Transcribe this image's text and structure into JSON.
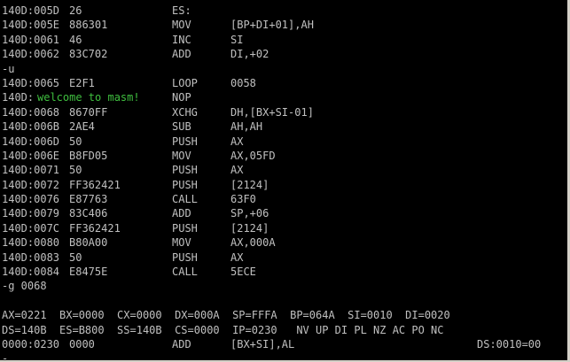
{
  "disasm1": [
    {
      "addr": "140D:005D",
      "bytes": "26",
      "mnem": "ES:",
      "op": ""
    },
    {
      "addr": "140D:005E",
      "bytes": "886301",
      "mnem": "MOV",
      "op": "[BP+DI+01],AH"
    },
    {
      "addr": "140D:0061",
      "bytes": "46",
      "mnem": "INC",
      "op": "SI"
    },
    {
      "addr": "140D:0062",
      "bytes": "83C702",
      "mnem": "ADD",
      "op": "DI,+02"
    }
  ],
  "cmd_u": "-u",
  "disasm2": [
    {
      "addr": "140D:0065",
      "bytes": "E2F1",
      "mnem": "LOOP",
      "op": "0058"
    }
  ],
  "welcome_line": {
    "addr": "140D:",
    "text": "welcome to masm!",
    "mnem": "NOP"
  },
  "disasm3": [
    {
      "addr": "140D:0068",
      "bytes": "8670FF",
      "mnem": "XCHG",
      "op": "DH,[BX+SI-01]"
    },
    {
      "addr": "140D:006B",
      "bytes": "2AE4",
      "mnem": "SUB",
      "op": "AH,AH"
    },
    {
      "addr": "140D:006D",
      "bytes": "50",
      "mnem": "PUSH",
      "op": "AX"
    },
    {
      "addr": "140D:006E",
      "bytes": "B8FD05",
      "mnem": "MOV",
      "op": "AX,05FD"
    },
    {
      "addr": "140D:0071",
      "bytes": "50",
      "mnem": "PUSH",
      "op": "AX"
    },
    {
      "addr": "140D:0072",
      "bytes": "FF362421",
      "mnem": "PUSH",
      "op": "[2124]"
    },
    {
      "addr": "140D:0076",
      "bytes": "E87763",
      "mnem": "CALL",
      "op": "63F0"
    },
    {
      "addr": "140D:0079",
      "bytes": "83C406",
      "mnem": "ADD",
      "op": "SP,+06"
    },
    {
      "addr": "140D:007C",
      "bytes": "FF362421",
      "mnem": "PUSH",
      "op": "[2124]"
    },
    {
      "addr": "140D:0080",
      "bytes": "B80A00",
      "mnem": "MOV",
      "op": "AX,000A"
    },
    {
      "addr": "140D:0083",
      "bytes": "50",
      "mnem": "PUSH",
      "op": "AX"
    },
    {
      "addr": "140D:0084",
      "bytes": "E8475E",
      "mnem": "CALL",
      "op": "5ECE"
    }
  ],
  "cmd_g": "-g 0068",
  "registers_line1": "AX=0221  BX=0000  CX=0000  DX=000A  SP=FFFA  BP=064A  SI=0010  DI=0020",
  "registers_line2": "DS=140B  ES=B800  SS=140B  CS=0000  IP=0230   NV UP DI PL NZ AC PO NC",
  "current_instr": {
    "addr": "0000:0230",
    "bytes": "0000",
    "mnem": "ADD",
    "op": "[BX+SI],AL",
    "mem": "DS:0010=00"
  },
  "prompt": "-"
}
